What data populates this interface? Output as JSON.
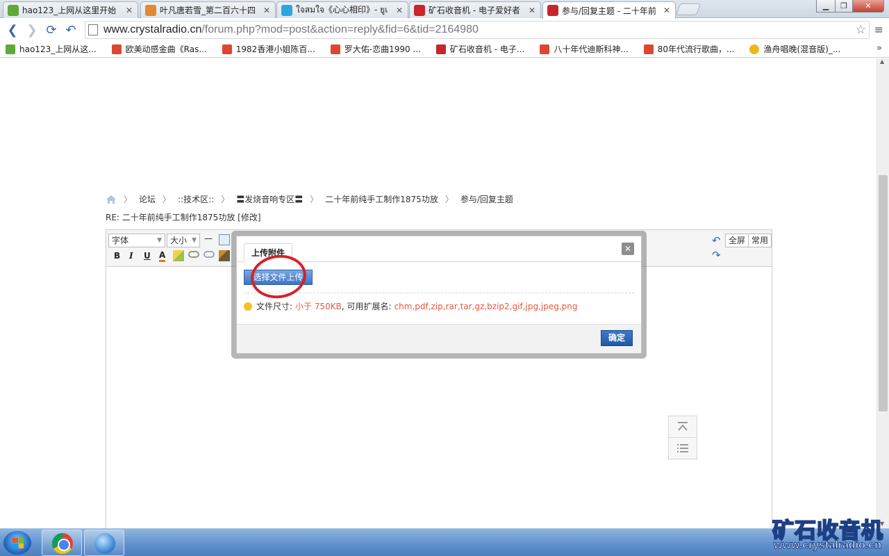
{
  "browser": {
    "tabs": [
      {
        "title": "hao123_上网从这里开始",
        "close": "✕",
        "color": "#5fa83a"
      },
      {
        "title": "叶凡唐若雪_第二百六十四",
        "close": "✕",
        "color": "#e08a2f"
      },
      {
        "title": "ใจสมใจ《心心相印》- ยูเ",
        "close": "✕",
        "color": "#2ca6e0"
      },
      {
        "title": "矿石收音机 - 电子爱好者",
        "close": "✕",
        "color": "#c8262c"
      },
      {
        "title": "参与/回复主题 - 二十年前",
        "close": "✕",
        "color": "#c8262c"
      }
    ],
    "url_host": "www.crystalradio.cn",
    "url_path": "/forum.php?mod=post&action=reply&fid=6&tid=2164980",
    "bookmarks": [
      {
        "label": "hao123_上网从这...",
        "color": "#5fa83a"
      },
      {
        "label": "欧美动感金曲《Ras...",
        "color": "#e0452f"
      },
      {
        "label": "1982香港小姐陈百...",
        "color": "#e0452f"
      },
      {
        "label": "罗大佑-恋曲1990 ...",
        "color": "#e0452f"
      },
      {
        "label": "矿石收音机 - 电子...",
        "color": "#c8262c"
      },
      {
        "label": "八十年代迪斯科神...",
        "color": "#e0452f"
      },
      {
        "label": "80年代流行歌曲，...",
        "color": "#e0452f"
      },
      {
        "label": "渔舟唱晚(混音版)_...",
        "color": "#f2b51e"
      }
    ],
    "bookmarks_more": "»"
  },
  "page": {
    "breadcrumb": [
      "论坛",
      "::技术区::",
      "〓发烧音响专区〓",
      "二十年前纯手工制作1875功放",
      "参与/回复主题"
    ],
    "breadcrumb_sep": "〉",
    "thread_title": "RE: 二十年前纯手工制作1875功放 [修改]",
    "editor": {
      "font_select": "字体",
      "size_select": "大小",
      "hr": "—",
      "bold": "B",
      "italic": "I",
      "underline": "U",
      "text_color": "A",
      "fullscreen": "全屏",
      "common": "常用"
    }
  },
  "dialog": {
    "tab": "上传附件",
    "close": "✕",
    "upload_button": "选择文件上传",
    "hint_prefix": "文件尺寸:",
    "size_limit": "小于 750KB",
    "hint_mid": ", 可用扩展名:",
    "extensions": "chm,pdf,zip,rar,tar,gz,bzip2,gif,jpg,jpeg,png",
    "ok": "确定"
  },
  "watermark": {
    "name": "矿石收音机",
    "url": "www.crystalradio.cn"
  }
}
